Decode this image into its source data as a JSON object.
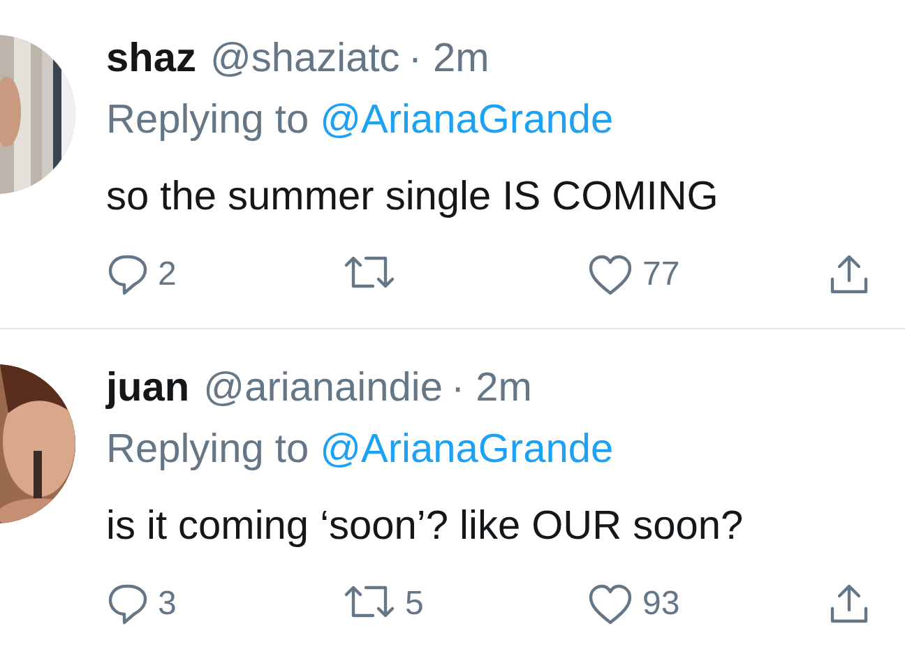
{
  "tweets": [
    {
      "name": "shaz",
      "handle": "@shaziatc",
      "time": "· 2m",
      "replying_prefix": "Replying to",
      "replying_to": "@ArianaGrande",
      "text": "so the summer single IS COMING",
      "replies": "2",
      "likes": "77"
    },
    {
      "name": "juan",
      "handle": "@arianaindie",
      "time": "· 2m",
      "replying_prefix": "Replying to",
      "replying_to": "@ArianaGrande",
      "text": "is it coming ‘soon’? like OUR soon?",
      "replies": "3",
      "retweets": "5",
      "likes": "93"
    }
  ]
}
